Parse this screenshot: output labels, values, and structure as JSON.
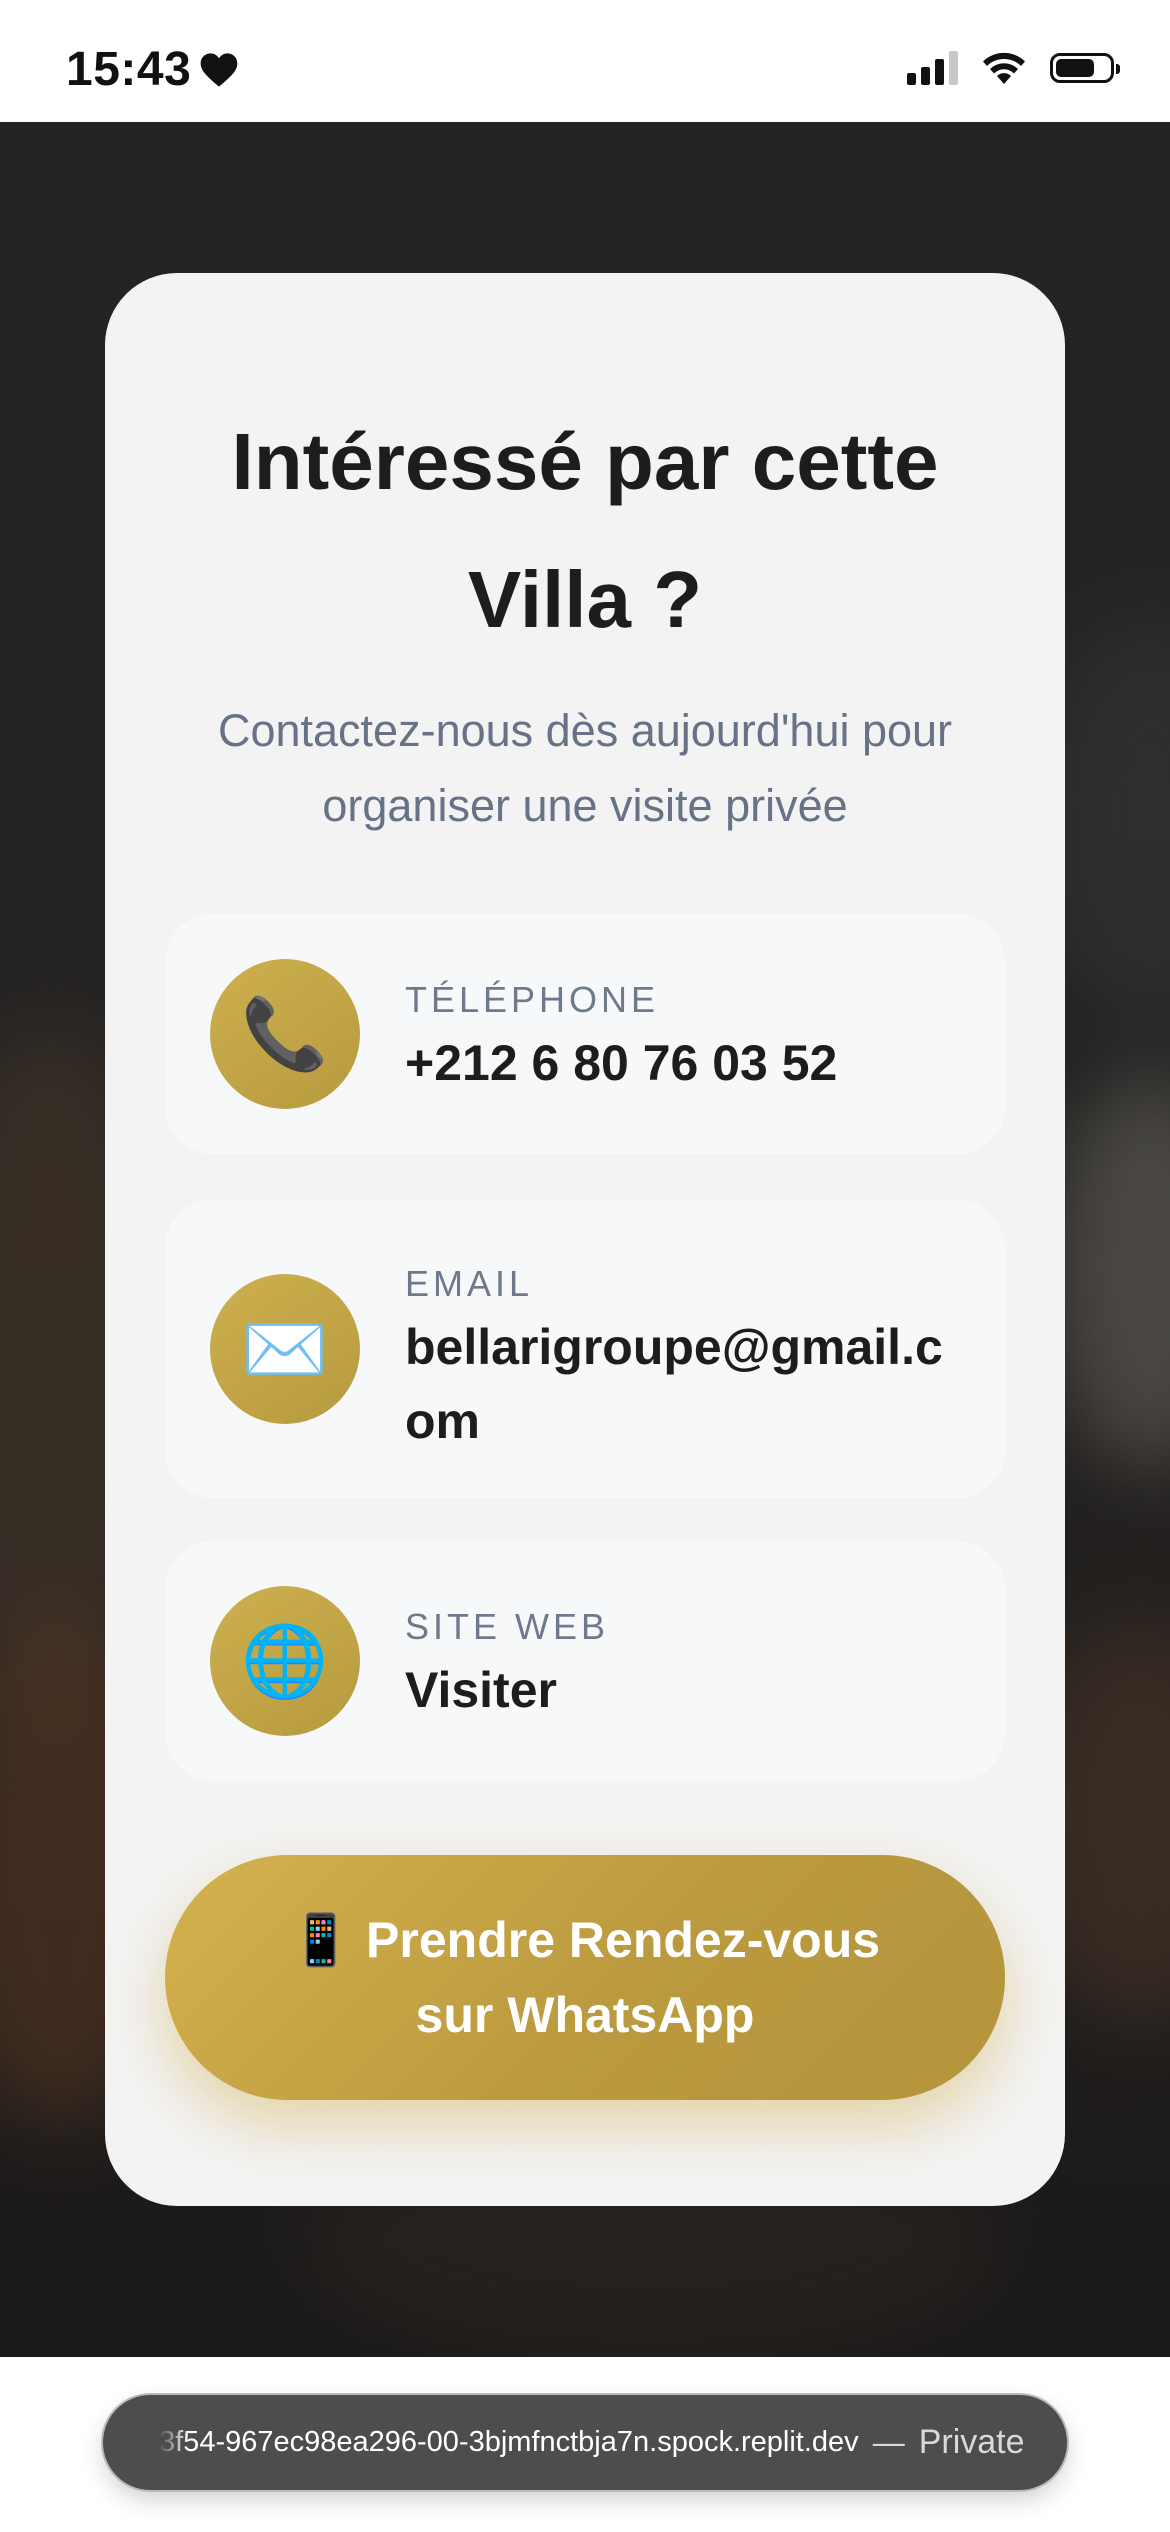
{
  "status_bar": {
    "time": "15:43",
    "heart_icon": "heart-icon",
    "signal_icon": "cellular-signal-icon",
    "wifi_icon": "wifi-icon",
    "battery_icon": "battery-icon"
  },
  "card": {
    "title": "Intéressé par cette Villa ?",
    "subtitle": "Contactez-nous dès aujourd'hui pour organiser une visite privée",
    "contacts": [
      {
        "icon": "📞",
        "icon_name": "telephone-icon",
        "label": "Téléphone",
        "value": "+212 6 80 76 03 52"
      },
      {
        "icon": "✉️",
        "icon_name": "envelope-icon",
        "label": "Email",
        "value": "bellarigroupe@gmail.com"
      },
      {
        "icon": "🌐",
        "icon_name": "globe-icon",
        "label": "Site Web",
        "value": "Visiter"
      }
    ],
    "whatsapp_button": "📱 Prendre Rendez-vous sur WhatsApp"
  },
  "browser": {
    "url": "3f54-967ec98ea296-00-3bjmfnctbja7n.spock.replit.dev",
    "separator": "—",
    "mode": "Private"
  },
  "colors": {
    "accent_gold": "#c6a848",
    "card_bg": "#f3f3f3",
    "item_bg": "#f7f8fa",
    "title_text": "#1d1d1f",
    "subtitle_text": "#677286"
  }
}
